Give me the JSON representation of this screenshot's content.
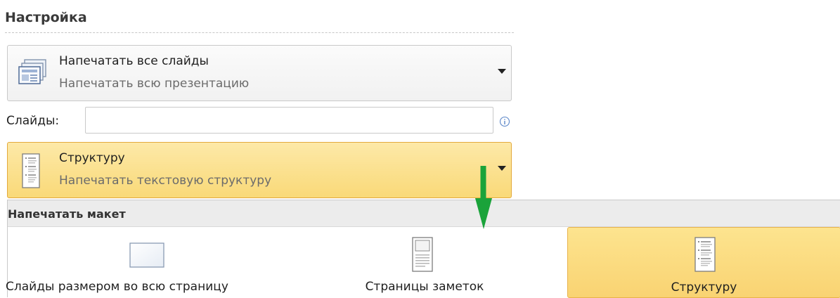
{
  "colors": {
    "accent_fill": "#f9d978",
    "accent_border": "#e3a93c",
    "arrow": "#1aa33a"
  },
  "section": {
    "title": "Настройка"
  },
  "range_dropdown": {
    "icon": "print-all-slides-icon",
    "title": "Напечатать все слайды",
    "subtitle": "Напечатать всю презентацию"
  },
  "slides_field": {
    "label": "Слайды:",
    "value": "",
    "info_icon": "info-icon"
  },
  "layout_dropdown": {
    "icon": "outline-page-icon",
    "title": "Структуру",
    "subtitle": "Напечатать текстовую структуру"
  },
  "layout_gallery": {
    "header": "Напечатать макет",
    "items": [
      {
        "icon": "full-page-slide-icon",
        "label": "Слайды размером во всю страницу",
        "selected": false
      },
      {
        "icon": "notes-page-icon",
        "label": "Страницы заметок",
        "selected": false
      },
      {
        "icon": "outline-page-icon",
        "label": "Структуру",
        "selected": true
      }
    ]
  },
  "annotation": {
    "icon": "arrow-down-icon"
  }
}
